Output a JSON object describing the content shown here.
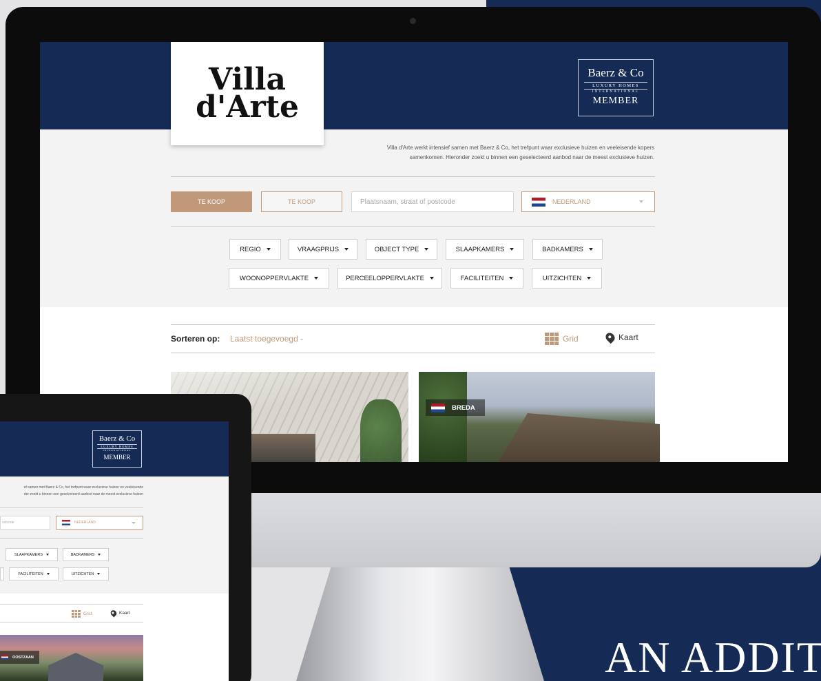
{
  "tagline": "AN ADDITI",
  "brand": {
    "logo_line1": "Villa",
    "logo_line2": "d'Arte",
    "partner_name": "Baerz & Co",
    "partner_sub": "LUXURY HOMES",
    "partner_sub2": "INTERNATIONAL",
    "partner_badge": "MEMBER"
  },
  "intro": {
    "line1": "Villa d'Arte werkt intensief samen met Baerz & Co, het trefpunt waar exclusieve huizen en veeleisende kopers",
    "line2": "samenkomen. Hieronder zoekt u binnen een geselecteerd aanbod naar de meest exclusieve huizen."
  },
  "search": {
    "tab_active": "TE KOOP",
    "tab_inactive": "TE KOOP",
    "placeholder": "Plaatsnaam, straat of postcode",
    "country": "NEDERLAND"
  },
  "filters": {
    "row1": [
      "REGIO",
      "VRAAGPRIJS",
      "OBJECT TYPE",
      "SLAAPKAMERS",
      "BADKAMERS"
    ],
    "row2": [
      "WOONOPPERVLAKTE",
      "PERCEELOPPERVLAKTE",
      "FACILITEITEN",
      "UITZICHTEN"
    ]
  },
  "sort": {
    "label": "Sorteren op:",
    "value": "Laatst toegevoegd -",
    "view_grid": "Grid",
    "view_map": "Kaart"
  },
  "listings": [
    {
      "city": ""
    },
    {
      "city": "BREDA"
    }
  ],
  "tablet": {
    "intro_line1": "ef samen met Baerz & Co, het trefpunt waar exclusieve huizen en veeleisende",
    "intro_line2": "der zoekt u binnen een geselecteerd aanbod naar de meest exclusieve huizen",
    "search_partial": "ostcode",
    "country": "NEDERLAND",
    "filters_row1": [
      "SLAAPKAMERS",
      "BADKAMERS"
    ],
    "filters_row2": [
      "FACILITEITEN",
      "UITZICHTEN"
    ],
    "view_grid": "Grid",
    "view_map": "Kaart",
    "listing_city": "OOSTZAAN"
  },
  "colors": {
    "navy": "#152b55",
    "accent": "#c0997a",
    "grey_bg": "#f3f3f3"
  }
}
